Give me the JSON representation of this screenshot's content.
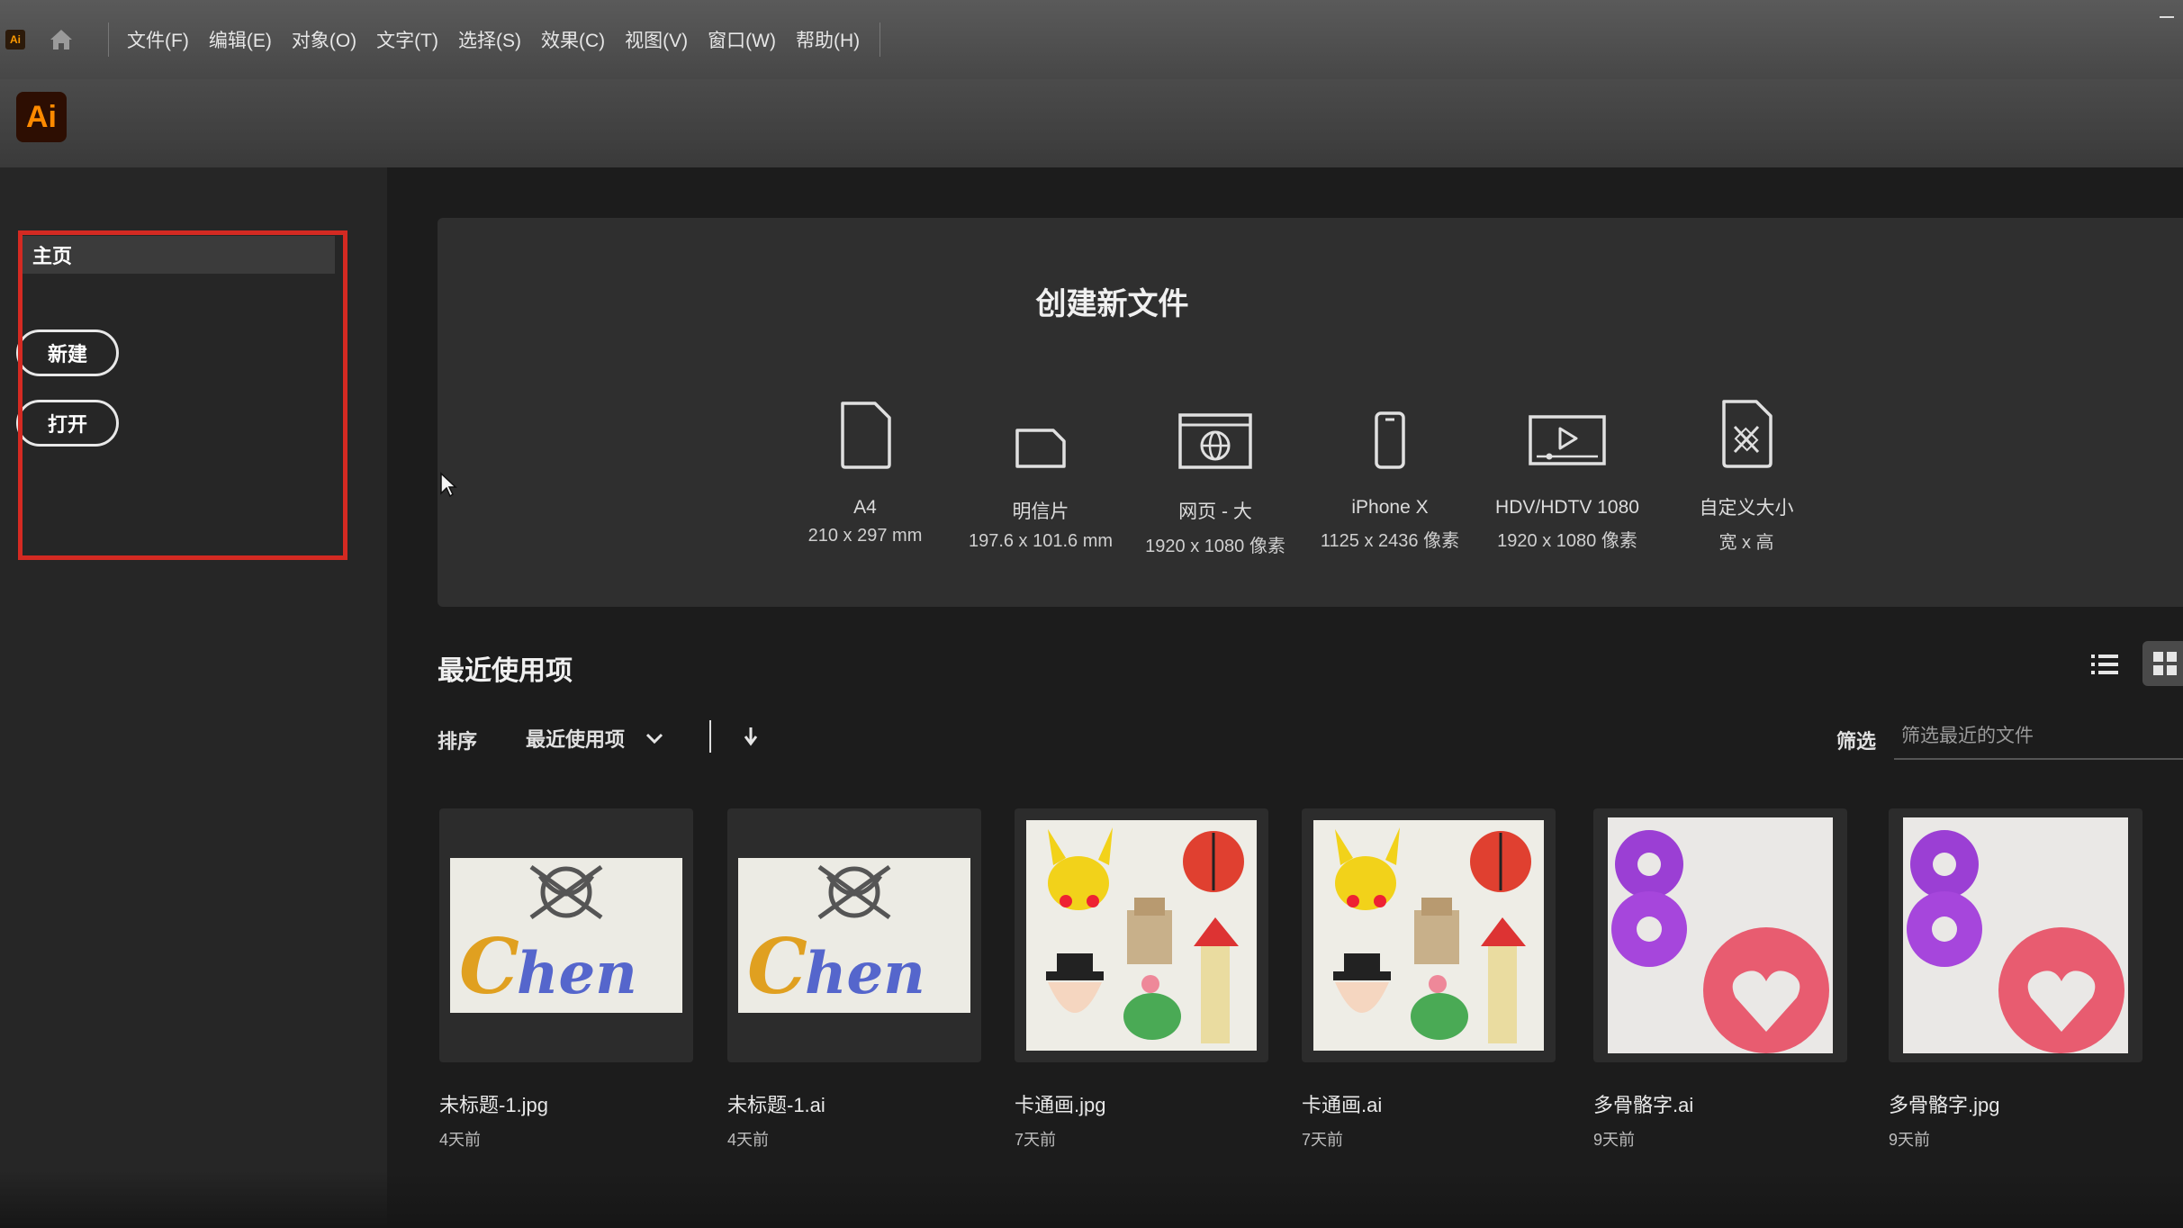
{
  "menubar": {
    "app_badge": "Ai",
    "items": [
      "文件(F)",
      "编辑(E)",
      "对象(O)",
      "文字(T)",
      "选择(S)",
      "效果(C)",
      "视图(V)",
      "窗口(W)",
      "帮助(H)"
    ]
  },
  "app": {
    "logo": "Ai"
  },
  "sidebar": {
    "home_label": "主页",
    "new_button": "新建",
    "open_button": "打开"
  },
  "create": {
    "title": "创建新文件",
    "presets": [
      {
        "name": "A4",
        "size": "210 x 297 mm",
        "icon": "document-icon"
      },
      {
        "name": "明信片",
        "size": "197.6 x 101.6 mm",
        "icon": "postcard-icon"
      },
      {
        "name": "网页 - 大",
        "size": "1920 x 1080 像素",
        "icon": "web-icon"
      },
      {
        "name": "iPhone X",
        "size": "1125 x 2436 像素",
        "icon": "phone-icon"
      },
      {
        "name": "HDV/HDTV 1080",
        "size": "1920 x 1080 像素",
        "icon": "video-icon"
      },
      {
        "name": "自定义大小",
        "size": "宽 x 高",
        "icon": "custom-size-icon"
      }
    ]
  },
  "recent": {
    "title": "最近使用项",
    "sort_label": "排序",
    "sort_value": "最近使用项",
    "filter_label": "筛选",
    "filter_placeholder": "筛选最近的文件",
    "files": [
      {
        "name": "未标题-1.jpg",
        "age": "4天前",
        "thumb": "chen"
      },
      {
        "name": "未标题-1.ai",
        "age": "4天前",
        "thumb": "chen"
      },
      {
        "name": "卡通画.jpg",
        "age": "7天前",
        "thumb": "cartoon"
      },
      {
        "name": "卡通画.ai",
        "age": "7天前",
        "thumb": "cartoon"
      },
      {
        "name": "多骨骼字.ai",
        "age": "9天前",
        "thumb": "bones"
      },
      {
        "name": "多骨骼字.jpg",
        "age": "9天前",
        "thumb": "bones"
      }
    ]
  },
  "colors": {
    "highlight": "#d42a22",
    "ai_orange": "#ff8a00",
    "ai_bg": "#2d0e02"
  }
}
